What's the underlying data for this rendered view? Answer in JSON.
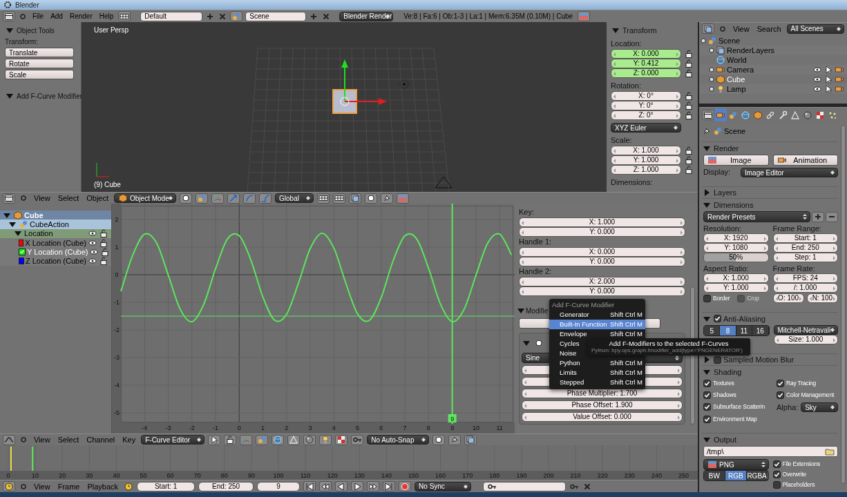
{
  "window": {
    "title": "Blender"
  },
  "info_header": {
    "menus": [
      "File",
      "Add",
      "Render",
      "Help"
    ],
    "layout": "Default",
    "scene": "Scene",
    "engine": "Blender Render",
    "stats": "Ve:8 | Fa:6 | Ob:1-3 | La:1 | Mem:6.35M (0.10M) | Cube"
  },
  "tool_shelf": {
    "panels": [
      {
        "title": "Object Tools",
        "expanded": true,
        "label": "Transform:",
        "buttons": [
          "Translate",
          "Rotate",
          "Scale"
        ]
      },
      {
        "title": "Add F-Curve Modifier",
        "expanded": true
      }
    ]
  },
  "viewport": {
    "view_name": "User Persp",
    "object_label": "(9) Cube"
  },
  "transform_panel": {
    "title": "Transform",
    "expanded": true,
    "items": [
      {
        "kind": "label",
        "text": "Location:"
      },
      {
        "kind": "fields",
        "values": [
          "X: 0.000",
          "Y: 0.412",
          "Z: 0.000"
        ],
        "animated": true
      },
      {
        "kind": "label",
        "text": "Rotation:"
      },
      {
        "kind": "fields",
        "values": [
          "X: 0°",
          "Y: 0°",
          "Z: 0°"
        ],
        "animated": false
      },
      {
        "kind": "dropdown",
        "text": "XYZ Euler"
      },
      {
        "kind": "label",
        "text": "Scale:"
      },
      {
        "kind": "fields",
        "values": [
          "X: 1.000",
          "Y: 1.000",
          "Z: 1.000"
        ],
        "animated": false
      },
      {
        "kind": "label",
        "text": "Dimensions:"
      }
    ]
  },
  "view3d_header": {
    "menus": [
      "View",
      "Select",
      "Object"
    ],
    "mode": "Object Mode",
    "orientation": "Global"
  },
  "channels": [
    {
      "name": "Cube",
      "kind": "object",
      "expanded": true,
      "children": [
        {
          "name": "CubeAction",
          "kind": "action",
          "expanded": true,
          "children": [
            {
              "name": "Location",
              "kind": "group",
              "expanded": true,
              "children": [
                {
                  "name": "X Location (Cube)",
                  "kind": "curve",
                  "color": "#ff0000",
                  "selected": false
                },
                {
                  "name": "Y Location (Cube)",
                  "kind": "curve",
                  "color": "#00ff00",
                  "selected": true
                },
                {
                  "name": "Z Location (Cube)",
                  "kind": "curve",
                  "color": "#0000ff",
                  "selected": false
                }
              ]
            }
          ]
        }
      ]
    }
  ],
  "graph": {
    "chart_data": {
      "type": "line",
      "x": [
        -5,
        -4.5,
        -4,
        -3.5,
        -3,
        -2.5,
        -2,
        -1.5,
        -1,
        -0.5,
        0,
        0.5,
        1,
        1.5,
        2,
        2.5,
        3,
        3.5,
        4,
        4.5,
        5,
        5.5,
        6,
        6.5,
        7,
        7.5,
        8,
        8.5,
        9,
        9.5,
        10,
        10.5,
        11,
        11.5
      ],
      "series": [
        {
          "color": "#5ce65c",
          "values": [
            -0.6,
            0.71,
            1.47,
            1.16,
            -0.01,
            -1.24,
            -1.7,
            -1.07,
            0.22,
            1.29,
            1.41,
            0.51,
            -0.81,
            -1.65,
            -1.43,
            -0.31,
            0.95,
            1.5,
            0.96,
            -0.3,
            -1.42,
            -1.65,
            -0.82,
            0.5,
            1.41,
            1.29,
            0.23,
            -1.06,
            -1.7,
            -1.25,
            -0.02,
            1.15,
            1.47,
            0.72
          ]
        }
      ],
      "xlim": [
        -5,
        11.55
      ],
      "ylim": [
        -5.35,
        2.5
      ],
      "xticks": [
        -4,
        -3,
        -2,
        -1,
        0,
        1,
        2,
        3,
        4,
        5,
        6,
        7,
        8,
        9,
        10,
        11
      ],
      "yticks": [
        2,
        1,
        0,
        -1,
        -2,
        -3,
        -4,
        -5
      ],
      "grid": true,
      "ref_lines": [
        {
          "axis": "x",
          "value": 9,
          "label": "9"
        },
        {
          "axis": "y",
          "value": -1.5
        }
      ]
    }
  },
  "fcurve_panel": {
    "groups": [
      {
        "label": "Key:",
        "fields": [
          "X: 1.000",
          "Y: 0.000"
        ]
      },
      {
        "label": "Handle 1:",
        "fields": [
          "X: 0.000",
          "Y: 0.000"
        ]
      },
      {
        "label": "Handle 2:",
        "fields": [
          "X: 2.000",
          "Y: 0.000"
        ]
      }
    ],
    "modifiers": {
      "title": "Modifie",
      "expanded": true,
      "function": "Sine",
      "fields": [
        "Phase Multiplier: 1.700",
        "Phase Offset: 1.900",
        "Value Offset: 0.000"
      ]
    }
  },
  "add_modifier_menu": {
    "title": "Add F-Curve Modifier",
    "items": [
      {
        "label": "Generator",
        "shortcut": "Shift Ctrl M",
        "selected": false
      },
      {
        "label": "Built-In Function",
        "shortcut": "Shift Ctrl M",
        "selected": true
      },
      {
        "label": "Envelope",
        "shortcut": "Shift Ctrl M",
        "selected": false
      },
      {
        "label": "Cycles",
        "selected": false
      },
      {
        "label": "Noise",
        "selected": false
      },
      {
        "label": "Python",
        "shortcut": "Shift Ctrl M",
        "selected": false
      },
      {
        "label": "Limits",
        "shortcut": "Shift Ctrl M",
        "selected": false
      },
      {
        "label": "Stepped",
        "shortcut": "Shift Ctrl M",
        "selected": false
      }
    ]
  },
  "tooltip": {
    "title": "Add F-Modifiers to the selected F-Curves",
    "python": "Python: bpy.ops.graph.fmodifier_add(type='FNGENERATOR')"
  },
  "graph_header": {
    "menus": [
      "View",
      "Select",
      "Channel",
      "Key"
    ],
    "editor": "F-Curve Editor",
    "snap": "No Auto-Snap"
  },
  "timeline": {
    "ticks": [
      "0",
      "10",
      "20",
      "30",
      "40",
      "50",
      "60",
      "70",
      "80",
      "90",
      "100",
      "110",
      "120",
      "130",
      "140",
      "150",
      "160",
      "170",
      "180",
      "190",
      "200",
      "210",
      "220",
      "230",
      "240",
      "250"
    ]
  },
  "timeline_header": {
    "menus": [
      "View",
      "Frame",
      "Playback"
    ],
    "start": "Start: 1",
    "end": "End: 250",
    "frame": "9",
    "sync": "No Sync"
  },
  "outliner": {
    "menus": [
      "View",
      "Search"
    ],
    "filter": "All Scenes",
    "tree": [
      {
        "name": "Scene",
        "kind": "scene",
        "selected": false,
        "children": [
          {
            "name": "RenderLayers",
            "kind": "layers",
            "selected": false
          },
          {
            "name": "World",
            "kind": "world",
            "selected": false
          },
          {
            "name": "Camera",
            "kind": "camera",
            "selected": false
          },
          {
            "name": "Cube",
            "kind": "mesh",
            "selected": true
          },
          {
            "name": "Lamp",
            "kind": "lamp",
            "selected": false
          }
        ]
      }
    ]
  },
  "properties": {
    "tabs": [
      {
        "kind": "render",
        "selected": true
      },
      {
        "kind": "scene",
        "selected": false
      },
      {
        "kind": "world",
        "selected": false
      },
      {
        "kind": "object",
        "selected": false
      },
      {
        "kind": "constraints",
        "selected": false
      },
      {
        "kind": "modifiers",
        "selected": false
      },
      {
        "kind": "data",
        "selected": false
      },
      {
        "kind": "material",
        "selected": false
      },
      {
        "kind": "texture",
        "selected": false
      },
      {
        "kind": "particles",
        "selected": false
      }
    ],
    "context": "Scene",
    "panels": [
      {
        "title": "Render",
        "kind": "plain",
        "expanded": true,
        "rows": [
          [
            {
              "kind": "button",
              "text": "Image"
            },
            {
              "kind": "button",
              "text": "Animation"
            }
          ],
          [
            {
              "kind": "label",
              "text": "Display:"
            },
            {
              "kind": "dropdown",
              "text": "Image Editor"
            }
          ]
        ]
      },
      {
        "title": "Layers",
        "kind": "plain",
        "expanded": false
      },
      {
        "title": "Dimensions",
        "kind": "plain",
        "expanded": true,
        "rows": [
          [
            {
              "kind": "preset",
              "text": "Render Presets"
            }
          ],
          [
            {
              "kind": "stack",
              "items": [
                {
                  "kind": "label",
                  "text": "Resolution:"
                },
                {
                  "kind": "field",
                  "text": "X: 1920"
                },
                {
                  "kind": "field",
                  "text": "Y: 1080"
                },
                {
                  "kind": "slider",
                  "text": "50%",
                  "level": 0.5
                }
              ]
            },
            {
              "kind": "stack",
              "items": [
                {
                  "kind": "label",
                  "text": "Frame Range:"
                },
                {
                  "kind": "field",
                  "text": "Start: 1"
                },
                {
                  "kind": "field",
                  "text": "End: 250"
                },
                {
                  "kind": "field",
                  "text": "Step: 1"
                }
              ]
            }
          ],
          [
            {
              "kind": "stack",
              "items": [
                {
                  "kind": "label",
                  "text": "Aspect Ratio:"
                },
                {
                  "kind": "field",
                  "text": "X: 1.000"
                },
                {
                  "kind": "field",
                  "text": "Y: 1.000"
                },
                {
                  "kind": "row",
                  "items": [
                    {
                      "kind": "checkbox",
                      "text": "Border",
                      "checked": false,
                      "disabled": false
                    },
                    {
                      "kind": "checkbox",
                      "text": "Crop",
                      "checked": false,
                      "disabled": true
                    }
                  ]
                }
              ]
            },
            {
              "kind": "stack",
              "items": [
                {
                  "kind": "label",
                  "text": "Frame Rate:"
                },
                {
                  "kind": "field",
                  "text": "FPS: 24"
                },
                {
                  "kind": "field",
                  "text": "/: 1.000"
                },
                {
                  "kind": "row",
                  "items": [
                    {
                      "kind": "field",
                      "text": "O: 100"
                    },
                    {
                      "kind": "field",
                      "text": "N: 100"
                    }
                  ]
                }
              ]
            }
          ]
        ]
      },
      {
        "title": "Anti-Aliasing",
        "kind": "toggle",
        "expanded": true,
        "checked": true,
        "rows": [
          [
            {
              "kind": "segmented",
              "options": [
                {
                  "text": "5",
                  "selected": false
                },
                {
                  "text": "8",
                  "selected": true
                },
                {
                  "text": "11",
                  "selected": false
                },
                {
                  "text": "16",
                  "selected": false
                }
              ]
            },
            {
              "kind": "stack",
              "items": [
                {
                  "kind": "dropdown",
                  "text": "Mitchell-Netravali"
                },
                {
                  "kind": "field",
                  "text": "Size: 1.000"
                }
              ]
            }
          ]
        ]
      },
      {
        "title": "Sampled Motion Blur",
        "kind": "toggle",
        "expanded": false,
        "checked": false
      },
      {
        "title": "Shading",
        "kind": "plain",
        "expanded": true,
        "rows": [
          [
            {
              "kind": "checkbox",
              "text": "Textures",
              "checked": true,
              "disabled": false
            },
            {
              "kind": "checkbox",
              "text": "Ray Tracing",
              "checked": true,
              "disabled": false
            }
          ],
          [
            {
              "kind": "checkbox",
              "text": "Shadows",
              "checked": true,
              "disabled": false
            },
            {
              "kind": "checkbox",
              "text": "Color Management",
              "checked": true,
              "disabled": false
            }
          ],
          [
            {
              "kind": "checkbox",
              "text": "Subsurface Scatterin",
              "checked": true,
              "disabled": false
            },
            {
              "kind": "row",
              "items": [
                {
                  "kind": "label",
                  "text": "Alpha:"
                },
                {
                  "kind": "dropdown",
                  "text": "Sky"
                }
              ]
            }
          ],
          [
            {
              "kind": "checkbox",
              "text": "Environment Map",
              "checked": true,
              "disabled": false
            }
          ]
        ]
      },
      {
        "title": "Output",
        "kind": "plain",
        "expanded": true,
        "rows": [
          [
            {
              "kind": "path",
              "text": "/tmp\\"
            }
          ],
          [
            {
              "kind": "stack",
              "items": [
                {
                  "kind": "image-dropdown",
                  "text": "PNG"
                },
                {
                  "kind": "segmented",
                  "options": [
                    {
                      "text": "BW",
                      "selected": false
                    },
                    {
                      "text": "RGB",
                      "selected": true
                    },
                    {
                      "text": "RGBA",
                      "selected": false
                    }
                  ]
                }
              ]
            },
            {
              "kind": "stack",
              "items": [
                {
                  "kind": "checkbox",
                  "text": "File Extensions",
                  "checked": true,
                  "disabled": false
                },
                {
                  "kind": "checkbox",
                  "text": "Overwrite",
                  "checked": true,
                  "disabled": false
                },
                {
                  "kind": "checkbox",
                  "text": "Placeholders",
                  "checked": false,
                  "disabled": false
                }
              ]
            }
          ]
        ]
      }
    ]
  }
}
